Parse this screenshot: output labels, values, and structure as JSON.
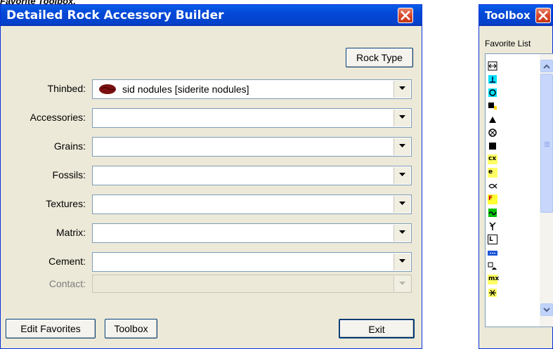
{
  "caption": "Favorite Toolbox.",
  "main_window": {
    "title": "Detailed Rock Accessory Builder",
    "rock_type_button": "Rock Type",
    "rows": [
      {
        "label": "Thinbed:",
        "value": "sid nodules [siderite nodules]",
        "enabled": true
      },
      {
        "label": "Accessories:",
        "value": "",
        "enabled": true
      },
      {
        "label": "Grains:",
        "value": "",
        "enabled": true
      },
      {
        "label": "Fossils:",
        "value": "",
        "enabled": true
      },
      {
        "label": "Textures:",
        "value": "",
        "enabled": true
      },
      {
        "label": "Matrix:",
        "value": "",
        "enabled": true
      },
      {
        "label": "Cement:",
        "value": "",
        "enabled": true
      },
      {
        "label": "Contact:",
        "value": "",
        "enabled": false
      }
    ],
    "buttons": {
      "edit_favorites": "Edit Favorites",
      "toolbox": "Toolbox",
      "exit": "Exit"
    }
  },
  "toolbox_window": {
    "title": "Toolbox",
    "favorite_list_label": "Favorite List",
    "favorite_items": [
      {
        "icon": "double-arrow-icon"
      },
      {
        "icon": "cyan-t-symbol-icon"
      },
      {
        "icon": "cyan-circle-symbol-icon"
      },
      {
        "icon": "black-square-pair-icon"
      },
      {
        "icon": "black-triangle-icon"
      },
      {
        "icon": "circled-cross-icon"
      },
      {
        "icon": "black-square-icon"
      },
      {
        "icon": "cx-symbol-icon",
        "text": "cx"
      },
      {
        "icon": "e-symbol-icon",
        "text": "e"
      },
      {
        "icon": "fish-symbol-icon"
      },
      {
        "icon": "f-symbol-icon",
        "text": "F"
      },
      {
        "icon": "green-wave-icon"
      },
      {
        "icon": "branch-symbol-icon"
      },
      {
        "icon": "boxed-l-icon",
        "text": "L"
      },
      {
        "icon": "blue-bar-icon"
      },
      {
        "icon": "shell-pair-icon"
      },
      {
        "icon": "mx-symbol-icon",
        "text": "mx"
      },
      {
        "icon": "star-symbol-icon"
      }
    ]
  },
  "colors": {
    "title_bar": "#0348d7",
    "close_red": "#d8462b",
    "nodule": "#7a1010"
  }
}
